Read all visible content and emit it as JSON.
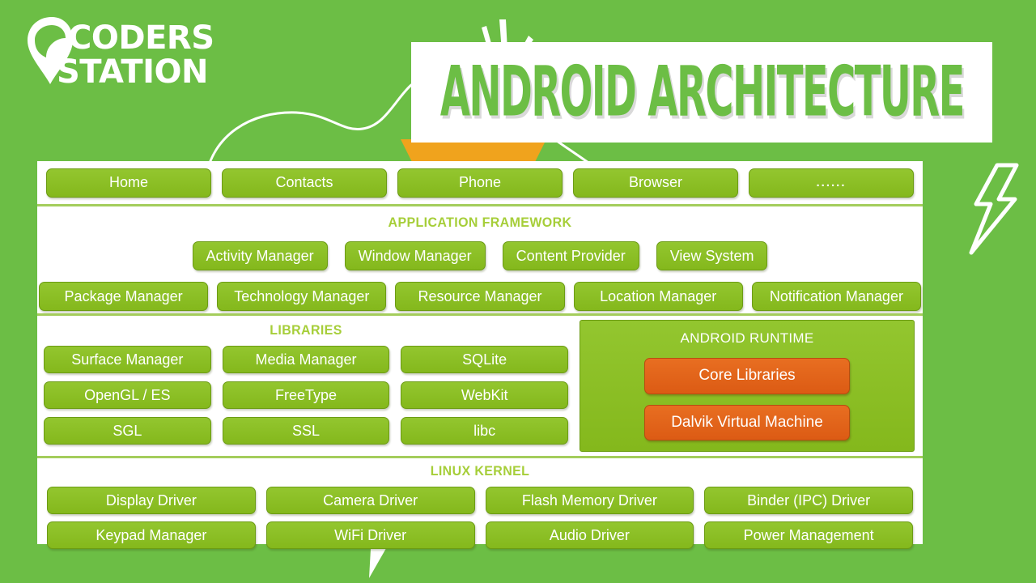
{
  "brand": {
    "line1": "CODERS",
    "line2": "STATION"
  },
  "title": {
    "text": "ANDROID ARCHITECTURE"
  },
  "colors": {
    "background_green": "#6cbe45",
    "pill_green": "#8cc024",
    "heading_green": "#a6ce39",
    "runtime_orange": "#e2641b",
    "panel_white": "#ffffff",
    "frame_green": "#a4cd5c"
  },
  "diagram": {
    "applications": {
      "items": [
        {
          "label": "Home"
        },
        {
          "label": "Contacts"
        },
        {
          "label": "Phone"
        },
        {
          "label": "Browser"
        },
        {
          "label": "......"
        }
      ]
    },
    "framework": {
      "heading": "APPLICATION FRAMEWORK",
      "row1": [
        {
          "label": "Activity Manager"
        },
        {
          "label": "Window Manager"
        },
        {
          "label": "Content Provider"
        },
        {
          "label": "View System"
        }
      ],
      "row2": [
        {
          "label": "Package Manager"
        },
        {
          "label": "Technology Manager"
        },
        {
          "label": "Resource Manager"
        },
        {
          "label": "Location Manager"
        },
        {
          "label": "Notification Manager"
        }
      ]
    },
    "libraries": {
      "heading": "LIBRARIES",
      "columns": [
        [
          {
            "label": "Surface Manager"
          },
          {
            "label": "OpenGL / ES"
          },
          {
            "label": "SGL"
          }
        ],
        [
          {
            "label": "Media Manager"
          },
          {
            "label": "FreeType"
          },
          {
            "label": "SSL"
          }
        ],
        [
          {
            "label": "SQLite"
          },
          {
            "label": "WebKit"
          },
          {
            "label": "libc"
          }
        ]
      ]
    },
    "runtime": {
      "heading": "ANDROID RUNTIME",
      "items": [
        {
          "label": "Core Libraries"
        },
        {
          "label": "Dalvik Virtual Machine"
        }
      ]
    },
    "kernel": {
      "heading": "LINUX KERNEL",
      "row1": [
        {
          "label": "Display Driver"
        },
        {
          "label": "Camera Driver"
        },
        {
          "label": "Flash Memory Driver"
        },
        {
          "label": "Binder (IPC) Driver"
        }
      ],
      "row2": [
        {
          "label": "Keypad Manager"
        },
        {
          "label": "WiFi Driver"
        },
        {
          "label": "Audio Driver"
        },
        {
          "label": "Power Management"
        }
      ]
    }
  }
}
